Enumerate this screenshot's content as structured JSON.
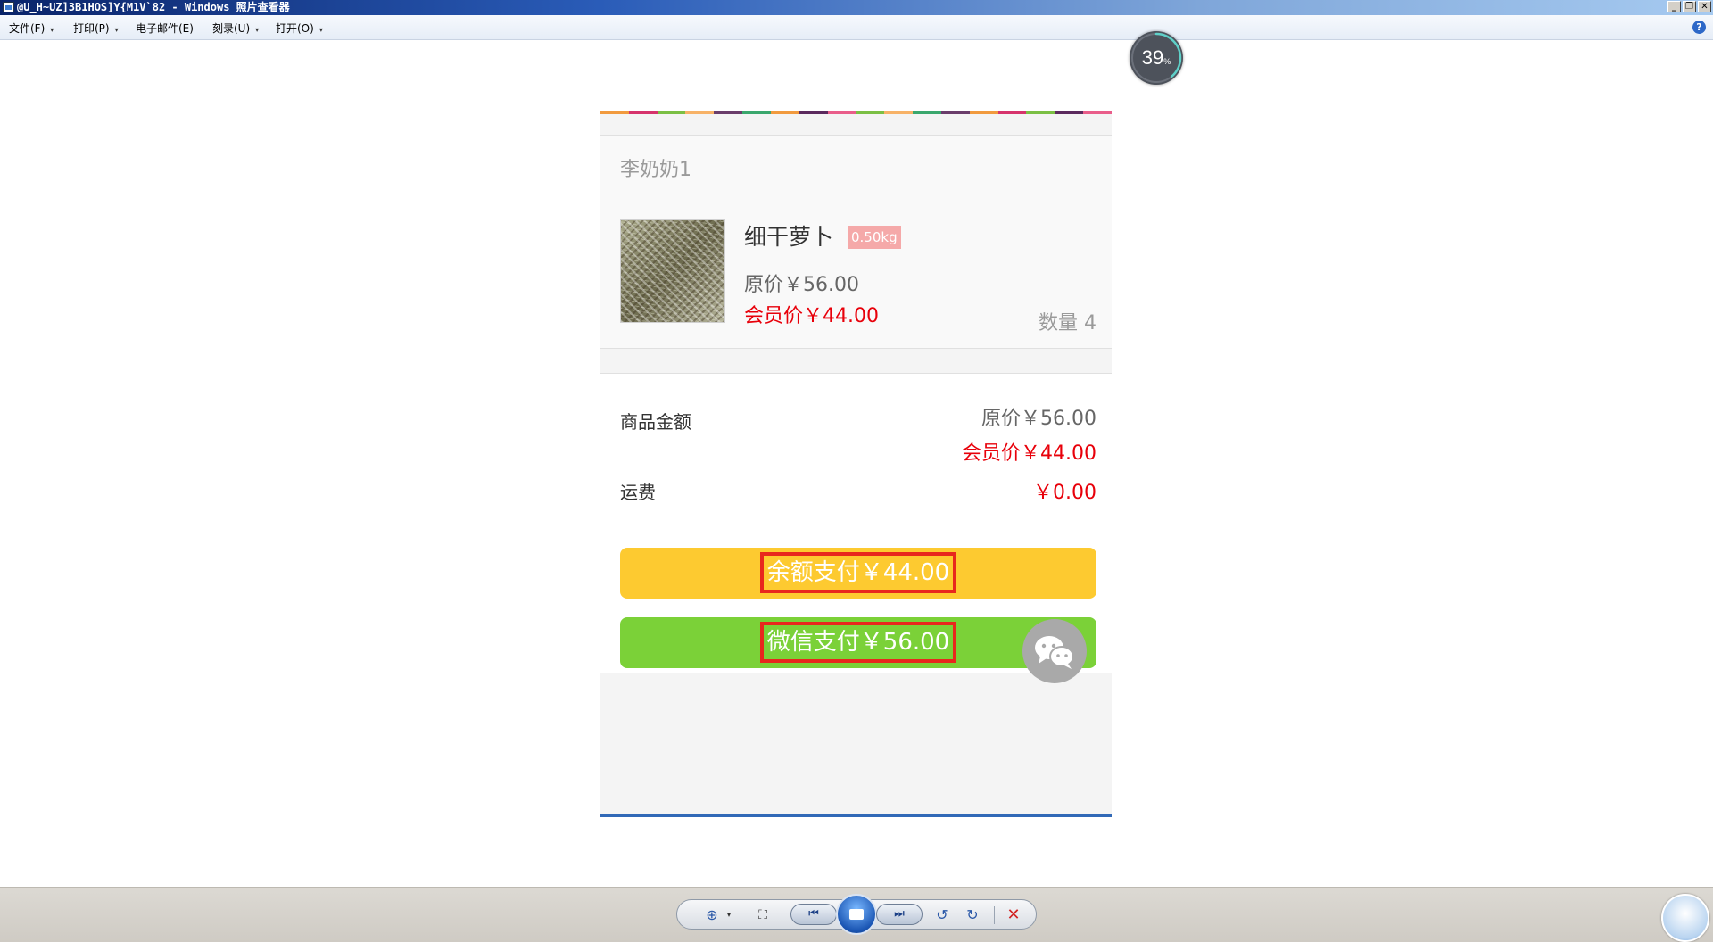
{
  "window": {
    "title": "@U_H~UZ]3B1HOS]Y{M1V`82 - Windows 照片查看器",
    "buttons": {
      "minimize": "_",
      "restore": "❐",
      "close": "✕"
    }
  },
  "menu": {
    "items": [
      {
        "label": "文件(F)",
        "has_dropdown": true
      },
      {
        "label": "打印(P)",
        "has_dropdown": true
      },
      {
        "label": "电子邮件(E)",
        "has_dropdown": false
      },
      {
        "label": "刻录(U)",
        "has_dropdown": true
      },
      {
        "label": "打开(O)",
        "has_dropdown": true
      }
    ],
    "caret": "▾",
    "help": "?"
  },
  "progress": {
    "value": "39",
    "unit": "%",
    "fraction": 0.39
  },
  "colors": {
    "stripe": [
      "#f19a3e",
      "#d6336c",
      "#7bbf44",
      "#f7b267",
      "#6a3d6b",
      "#3aa76d",
      "#f19a3e",
      "#5b2a5e",
      "#e95d8a",
      "#7bbf44",
      "#f7b267",
      "#3aa76d",
      "#6a3d6b",
      "#f19a3e",
      "#d6336c",
      "#7bbf44",
      "#5b2a5e",
      "#e95d8a"
    ],
    "price_red": "#e8000a",
    "balance_button": "#fdca30",
    "wechat_button": "#7bd138",
    "highlight_box": "#e8271d"
  },
  "order": {
    "shop_name": "李奶奶1",
    "product": {
      "name": "细干萝卜",
      "weight_tag": "0.50kg",
      "original_price": "原价￥56.00",
      "member_price": "会员价￥44.00",
      "quantity": "数量 4"
    },
    "summary": {
      "goods_label": "商品金额",
      "original_price": "原价￥56.00",
      "member_price": "会员价￥44.00",
      "shipping_label": "运费",
      "shipping_value": "￥0.00"
    },
    "pay_balance": "余额支付￥44.00",
    "pay_wechat": "微信支付￥56.00"
  },
  "toolbar": {
    "zoom": "⊕",
    "fit": "⛶",
    "prev": "⏮",
    "next": "⏭",
    "rotate_ccw": "↺",
    "rotate_cw": "↻",
    "delete": "✕"
  }
}
